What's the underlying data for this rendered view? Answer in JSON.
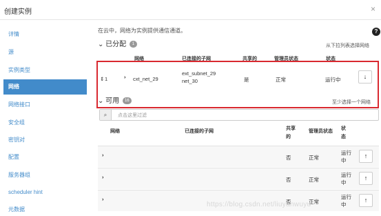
{
  "dialog": {
    "title": "创建实例",
    "close_symbol": "×"
  },
  "sidebar": {
    "items": [
      {
        "label": "详情",
        "active": false
      },
      {
        "label": "源",
        "active": false
      },
      {
        "label": "实例类型",
        "active": false
      },
      {
        "label": "网络",
        "active": true
      },
      {
        "label": "网络接口",
        "active": false
      },
      {
        "label": "安全组",
        "active": false
      },
      {
        "label": "密钥对",
        "active": false
      },
      {
        "label": "配置",
        "active": false
      },
      {
        "label": "服务器组",
        "active": false
      },
      {
        "label": "scheduler hint",
        "active": false
      },
      {
        "label": "元数据",
        "active": false
      }
    ]
  },
  "main": {
    "intro": "在云中，网络为实例提供通信通道。",
    "help_symbol": "?",
    "allocated": {
      "title": "已分配",
      "count": "1",
      "hint": "从下拉列表选择网络",
      "headers": {
        "network": "网络",
        "subnets": "已连接的子网",
        "shared": "共享的",
        "admin_state": "管理员状态",
        "status": "状态"
      },
      "row": {
        "order": "1",
        "name": "cxt_net_29",
        "subnet_line1": "ext_subnet_29",
        "subnet_line2": "net_30",
        "shared": "是",
        "admin_state": "正常",
        "status": "运行中"
      }
    },
    "available": {
      "title": "可用",
      "count": "16",
      "hint": "至少选择一个网络",
      "filter_placeholder": "点击这里过滤",
      "headers": {
        "network": "网络",
        "subnets": "已连接的子网",
        "shared_line1": "共享",
        "shared_line2": "的",
        "admin_state": "管理员状态",
        "status_line1": "状",
        "status_line2": "态"
      },
      "rows": [
        {
          "shared": "否",
          "admin_state": "正常",
          "status_line1": "运行",
          "status_line2": "中"
        },
        {
          "shared": "否",
          "admin_state": "正常",
          "status_line1": "运行",
          "status_line2": "中"
        },
        {
          "shared": "否",
          "admin_state": "正常",
          "status_line1": "运行",
          "status_line2": "中"
        }
      ]
    }
  },
  "watermark": "https://blog.csdn.net/liuyanwuyu"
}
